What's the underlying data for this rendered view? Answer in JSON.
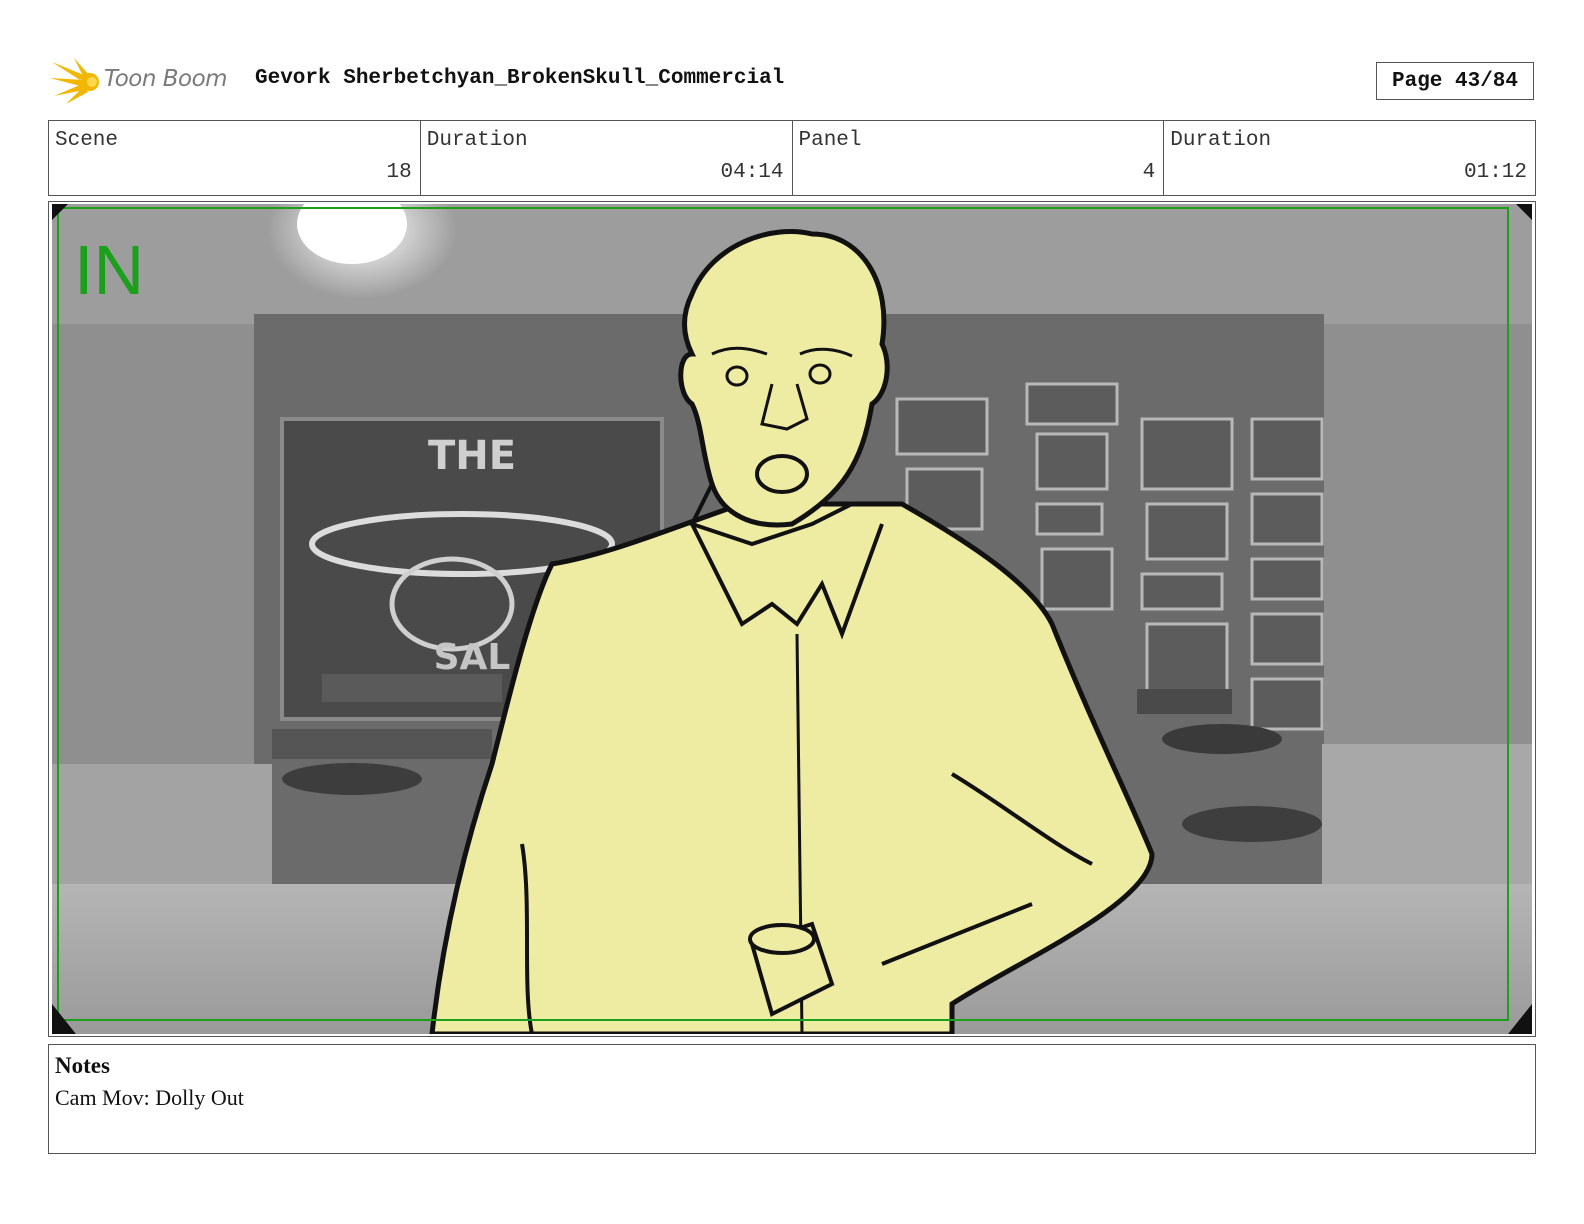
{
  "header": {
    "logo_text": "Toon Boom",
    "project_title": "Gevork Sherbetchyan_BrokenSkull_Commercial",
    "page": "Page 43/84"
  },
  "info": {
    "scene_label": "Scene",
    "scene_value": "18",
    "scene_duration_label": "Duration",
    "scene_duration_value": "04:14",
    "panel_label": "Panel",
    "panel_value": "4",
    "panel_duration_label": "Duration",
    "panel_duration_value": "01:12"
  },
  "panel": {
    "camera_label": "IN",
    "camera_frame_color": "#1aa01a",
    "character_fill": "#eeeba3"
  },
  "notes": {
    "title": "Notes",
    "text": "Cam Mov: Dolly Out"
  }
}
